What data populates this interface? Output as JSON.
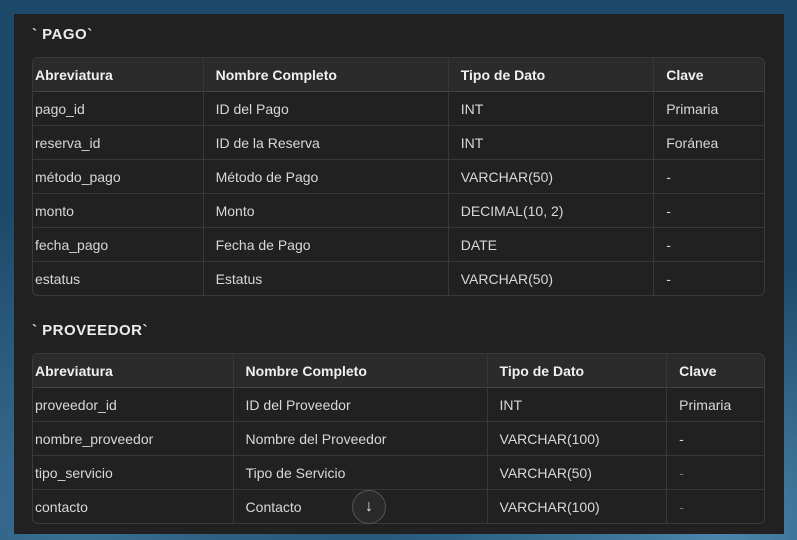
{
  "pago": {
    "title": "` PAGO`",
    "headers": [
      "Abreviatura",
      "Nombre Completo",
      "Tipo de Dato",
      "Clave"
    ],
    "rows": [
      [
        "pago_id",
        "ID del Pago",
        "INT",
        "Primaria"
      ],
      [
        "reserva_id",
        "ID de la Reserva",
        "INT",
        "Foránea"
      ],
      [
        "método_pago",
        "Método de Pago",
        "VARCHAR(50)",
        "-"
      ],
      [
        "monto",
        "Monto",
        "DECIMAL(10, 2)",
        "-"
      ],
      [
        "fecha_pago",
        "Fecha de Pago",
        "DATE",
        "-"
      ],
      [
        "estatus",
        "Estatus",
        "VARCHAR(50)",
        "-"
      ]
    ]
  },
  "proveedor": {
    "title": "` PROVEEDOR`",
    "headers": [
      "Abreviatura",
      "Nombre Completo",
      "Tipo de Dato",
      "Clave"
    ],
    "rows": [
      [
        "proveedor_id",
        "ID del Proveedor",
        "INT",
        "Primaria"
      ],
      [
        "nombre_proveedor",
        "Nombre del Proveedor",
        "VARCHAR(100)",
        "-"
      ],
      [
        "tipo_servicio",
        "Tipo de Servicio",
        "VARCHAR(50)",
        "-"
      ],
      [
        "contacto",
        "Contacto",
        "VARCHAR(100)",
        "-"
      ]
    ]
  },
  "scroll_button": {
    "icon": "arrow-down-icon",
    "glyph": "↓"
  }
}
